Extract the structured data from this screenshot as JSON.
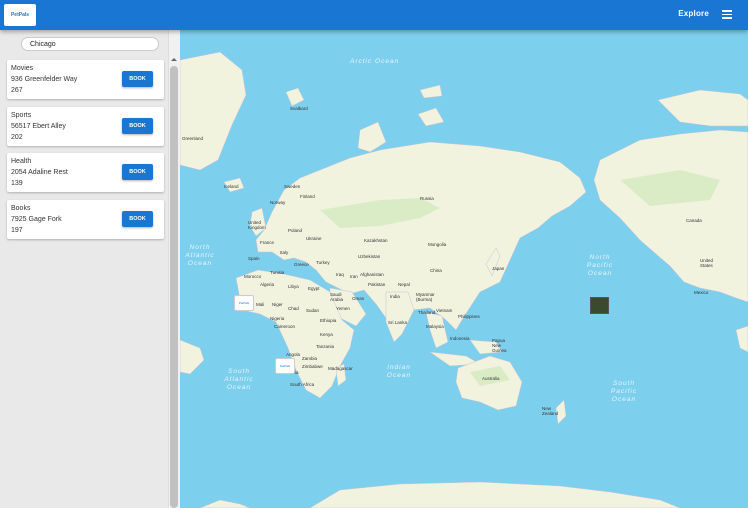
{
  "header": {
    "logo_text": "PetPals",
    "explore_label": "Explore",
    "menu_icon": "hamburger-menu-icon"
  },
  "sidebar": {
    "search": {
      "value": "Chicago"
    },
    "cards": [
      {
        "category": "Movies",
        "address": "936 Greenfelder Way",
        "count": "267",
        "button_label": "BOOK"
      },
      {
        "category": "Sports",
        "address": "56517 Ebert Alley",
        "count": "202",
        "button_label": "BOOK"
      },
      {
        "category": "Health",
        "address": "2054 Adaline Rest",
        "count": "139",
        "button_label": "BOOK"
      },
      {
        "category": "Books",
        "address": "7925 Gage Fork",
        "count": "197",
        "button_label": "BOOK"
      }
    ]
  },
  "map": {
    "oceans": [
      "Arctic Ocean",
      "North Atlantic Ocean",
      "South Atlantic Ocean",
      "Indian Ocean",
      "North Pacific Ocean",
      "South Pacific Ocean"
    ],
    "labels": [
      "Svalbard",
      "Greenland",
      "Iceland",
      "Sweden",
      "Norway",
      "Finland",
      "United Kingdom",
      "Poland",
      "France",
      "Ukraine",
      "Spain",
      "Italy",
      "Greece",
      "Turkey",
      "Morocco",
      "Tunisia",
      "Algeria",
      "Libya",
      "Egypt",
      "Mali",
      "Niger",
      "Chad",
      "Sudan",
      "Nigeria",
      "Cameroon",
      "Ethiopia",
      "Kenya",
      "Tanzania",
      "Angola",
      "Zambia",
      "Namibia",
      "Zimbabwe",
      "South Africa",
      "Madagascar",
      "Iraq",
      "Iran",
      "Saudi Arabia",
      "Oman",
      "Yemen",
      "Russia",
      "Kazakhstan",
      "Uzbekistan",
      "Afghanistan",
      "Pakistan",
      "India",
      "Nepal",
      "Myanmar (Burma)",
      "Sri Lanka",
      "Thailand",
      "Vietnam",
      "Malaysia",
      "Philippines",
      "Indonesia",
      "Papua New Guinea",
      "Mongolia",
      "China",
      "Japan",
      "Australia",
      "New Zealand",
      "Canada",
      "United States",
      "Mexico"
    ],
    "marker_text": "PetPals"
  }
}
